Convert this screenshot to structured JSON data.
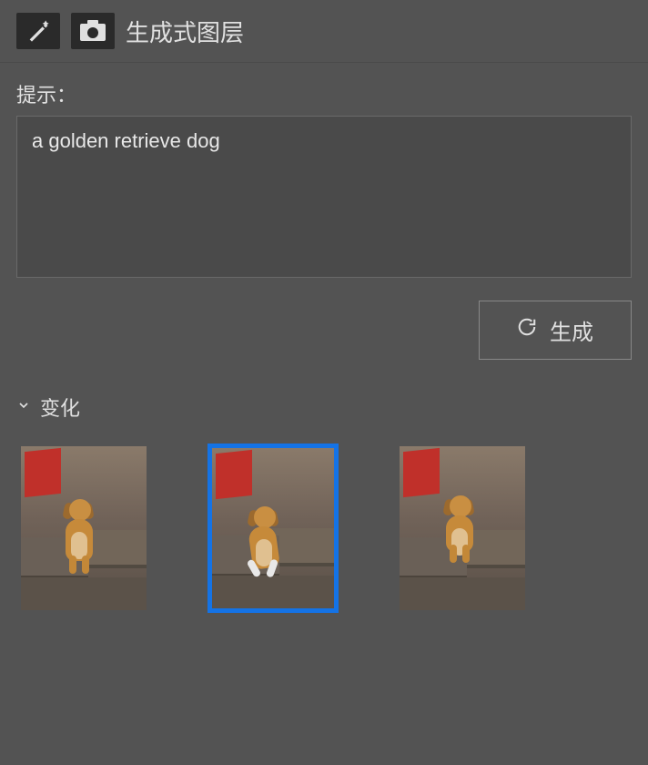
{
  "header": {
    "title": "生成式图层"
  },
  "prompt": {
    "label": "提示：",
    "value": "a golden retrieve dog"
  },
  "actions": {
    "generate_label": "生成"
  },
  "variations": {
    "title": "变化",
    "items": [
      {
        "selected": false,
        "alt": "golden retriever sitting on stone steps"
      },
      {
        "selected": true,
        "alt": "golden retriever lying on stone blocks"
      },
      {
        "selected": false,
        "alt": "golden retriever standing on stone ledge"
      }
    ]
  }
}
